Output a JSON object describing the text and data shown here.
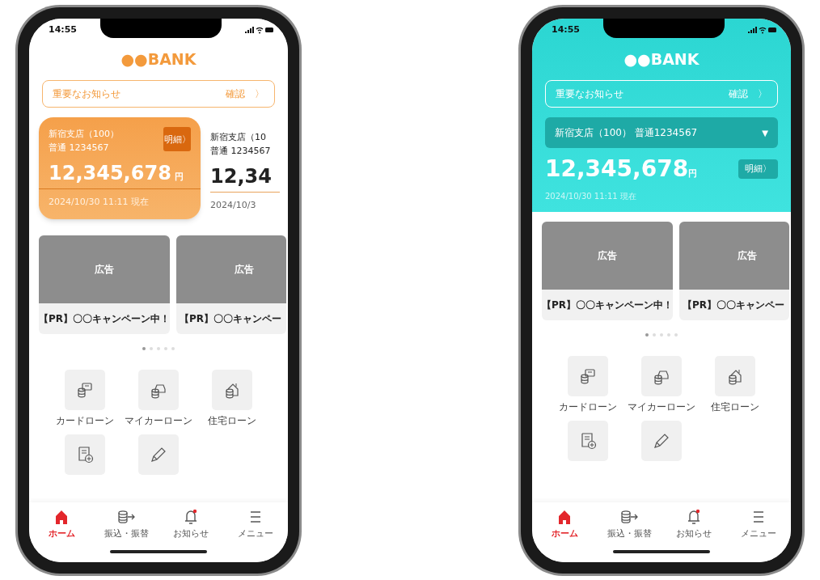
{
  "phones": [
    {
      "kind": "cards",
      "status_time": "14:55",
      "logo": "●●BANK",
      "notice": {
        "label": "重要なお知らせ",
        "action": "確認",
        "chevron": "〉"
      },
      "accounts": [
        {
          "branch": "新宿支店（100）",
          "number": "普通 1234567",
          "balance": "12,345,678",
          "unit": "円",
          "updated": "2024/10/30 11:11 現在",
          "detail": "明細〉"
        },
        {
          "branch": "新宿支店（10",
          "number": "普通 1234567",
          "balance": "12,34",
          "updated": "2024/10/3"
        }
      ],
      "ads": [
        {
          "label": "広告",
          "title": "【PR】〇〇キャンペーン中！"
        },
        {
          "label": "広告",
          "title": "【PR】〇〇キャンペー"
        }
      ],
      "pager": [
        {
          "selected": true
        },
        {
          "selected": false
        },
        {
          "selected": false
        },
        {
          "selected": false
        },
        {
          "selected": false
        }
      ],
      "shortcuts": [
        {
          "kind": "card",
          "label": "カードローン"
        },
        {
          "kind": "car",
          "label": "マイカーローン"
        },
        {
          "kind": "house",
          "label": "住宅ローン"
        },
        {
          "kind": "apply"
        },
        {
          "kind": "edit"
        }
      ],
      "nav": [
        {
          "kind": "home",
          "label": "ホーム",
          "selected": true
        },
        {
          "kind": "transfer",
          "label": "振込・振替",
          "selected": false
        },
        {
          "kind": "bell",
          "label": "お知らせ",
          "selected": false,
          "unread": true
        },
        {
          "kind": "menu",
          "label": "メニュー",
          "selected": false
        }
      ]
    },
    {
      "kind": "selector",
      "status_time": "14:55",
      "logo": "●●BANK",
      "notice": {
        "label": "重要なお知らせ",
        "action": "確認",
        "chevron": "〉"
      },
      "account": {
        "label": "新宿支店（100） 普通1234567",
        "caret": "▼",
        "balance": "12,345,678",
        "unit": "円",
        "detail": "明細〉",
        "updated": "2024/10/30 11:11 現在"
      },
      "ads": [
        {
          "label": "広告",
          "title": "【PR】〇〇キャンペーン中！"
        },
        {
          "label": "広告",
          "title": "【PR】〇〇キャンペー"
        }
      ],
      "pager": [
        {
          "selected": true
        },
        {
          "selected": false
        },
        {
          "selected": false
        },
        {
          "selected": false
        },
        {
          "selected": false
        }
      ],
      "shortcuts": [
        {
          "kind": "card",
          "label": "カードローン"
        },
        {
          "kind": "car",
          "label": "マイカーローン"
        },
        {
          "kind": "house",
          "label": "住宅ローン"
        },
        {
          "kind": "apply"
        },
        {
          "kind": "edit"
        }
      ],
      "nav": [
        {
          "kind": "home",
          "label": "ホーム",
          "selected": true
        },
        {
          "kind": "transfer",
          "label": "振込・振替",
          "selected": false
        },
        {
          "kind": "bell",
          "label": "お知らせ",
          "selected": false,
          "unread": true
        },
        {
          "kind": "menu",
          "label": "メニュー",
          "selected": false
        }
      ]
    }
  ]
}
